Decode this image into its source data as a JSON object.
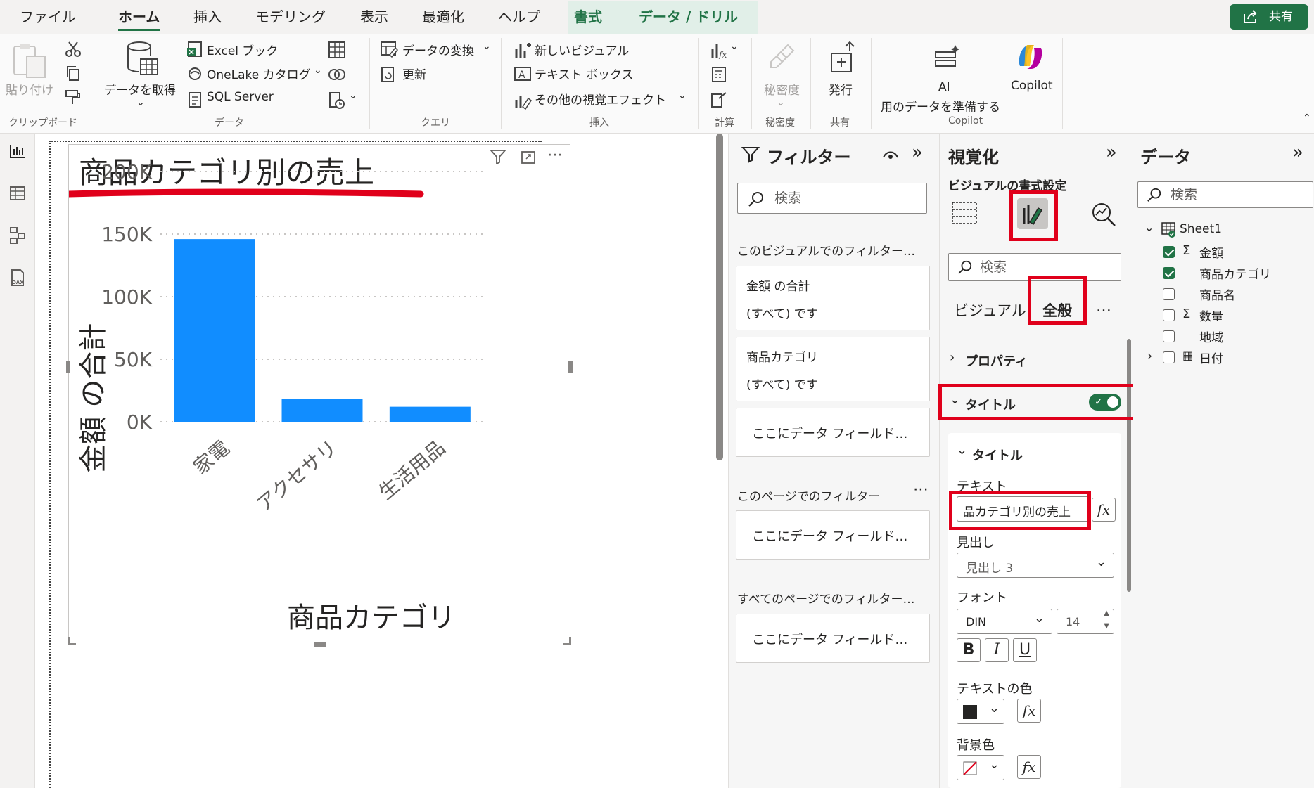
{
  "menu": {
    "items": [
      "ファイル",
      "ホーム",
      "挿入",
      "モデリング",
      "表示",
      "最適化",
      "ヘルプ",
      "書式",
      "データ / ドリル"
    ],
    "active": "ホーム",
    "share_label": "共有"
  },
  "ribbon": {
    "paste_label": "貼り付け",
    "get_data_label": "データを取得",
    "excel_label": "Excel ブック",
    "onelake_label": "OneLake カタログ",
    "sql_label": "SQL Server",
    "transform_label": "データの変換",
    "refresh_label": "更新",
    "new_visual_label": "新しいビジュアル",
    "textbox_label": "テキスト ボックス",
    "more_visuals_label": "その他の視覚エフェクト",
    "sensitivity_label": "秘密度",
    "publish_label": "発行",
    "ai_label": "AI",
    "ai_sub_label": "用のデータを準備する",
    "copilot_label": "Copilot",
    "groups": {
      "clipboard": "クリップボード",
      "data": "データ",
      "query": "クエリ",
      "insert": "挿入",
      "calc": "計算",
      "sensitivity": "秘密度",
      "share": "共有",
      "copilot": "Copilot"
    }
  },
  "chart_data": {
    "type": "bar",
    "title": "商品カテゴリ別の売上",
    "xlabel": "商品カテゴリ",
    "ylabel": "金額 の合計",
    "categories": [
      "家電",
      "アクセサリ",
      "生活用品"
    ],
    "values": [
      146000,
      18000,
      12000
    ],
    "ylim": [
      0,
      200000
    ],
    "yticks": [
      0,
      50000,
      100000,
      150000,
      200000
    ],
    "ytick_labels": [
      "0K",
      "50K",
      "100K",
      "150K",
      "200K"
    ],
    "grid": true,
    "bar_color": "#118dff"
  },
  "filters": {
    "title": "フィルター",
    "search_placeholder": "検索",
    "visual_section": "このビジュアルでのフィルター…",
    "card1_title": "金額 の合計",
    "card1_value": "(すべて) です",
    "card2_title": "商品カテゴリ",
    "card2_value": "(すべて) です",
    "drop_here": "ここにデータ フィールド…",
    "page_section": "このページでのフィルター",
    "all_pages_section": "すべてのページでのフィルター…"
  },
  "viz": {
    "title": "視覚化",
    "subtitle": "ビジュアルの書式設定",
    "search_placeholder": "検索",
    "tab_visual": "ビジュアル",
    "tab_general": "全般",
    "more": "…",
    "properties": "プロパティ",
    "title_section": "タイトル",
    "title_sub": "タイトル",
    "text_label": "テキスト",
    "text_value": "品カテゴリ別の売上",
    "heading_label": "見出し",
    "heading_value": "見出し 3",
    "font_label": "フォント",
    "font_value": "DIN",
    "font_size": "14",
    "bold": "B",
    "italic": "I",
    "underline": "U",
    "text_color_label": "テキストの色",
    "bg_color_label": "背景色",
    "fx": "fx"
  },
  "data_panel": {
    "title": "データ",
    "search_placeholder": "検索",
    "table": "Sheet1",
    "fields": [
      {
        "name": "金額",
        "checked": true,
        "sigma": true
      },
      {
        "name": "商品カテゴリ",
        "checked": true,
        "sigma": false
      },
      {
        "name": "商品名",
        "checked": false,
        "sigma": false
      },
      {
        "name": "数量",
        "checked": false,
        "sigma": true
      },
      {
        "name": "地域",
        "checked": false,
        "sigma": false
      },
      {
        "name": "日付",
        "checked": false,
        "sigma": false
      }
    ]
  }
}
